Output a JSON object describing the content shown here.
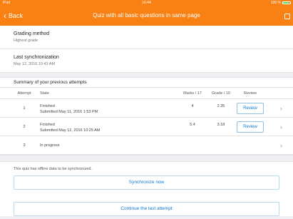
{
  "status_bar": {
    "carrier": "iPad",
    "time": "16:44",
    "battery": "100 %",
    "battery_color": "#4cd964"
  },
  "nav": {
    "back_label": "Back",
    "title": "Quiz with all basic questions in same page",
    "bar_color": "#f98012"
  },
  "info": [
    {
      "title": "Grading method",
      "value": "Highest grade"
    },
    {
      "title": "Last synchronization",
      "value": "May 12, 2016 10:43 AM"
    }
  ],
  "summary": {
    "title": "Summary of your previous attempts",
    "headers": {
      "attempt": "Attempt",
      "state": "State",
      "marks": "Marks / 17",
      "grade": "Grade / 10",
      "review": "Review"
    },
    "rows": [
      {
        "attempt": "1",
        "state": "Finished",
        "submitted": "Submitted May 11, 2016 1:53 PM",
        "marks": "4",
        "grade": "2.35",
        "review": "Review"
      },
      {
        "attempt": "2",
        "state": "Finished",
        "submitted": "Submitted May 12, 2016 10:25 AM",
        "marks": "5.4",
        "grade": "3.18",
        "review": "Review"
      },
      {
        "attempt": "3",
        "state": "In progress",
        "submitted": "",
        "marks": "",
        "grade": "",
        "review": ""
      }
    ]
  },
  "sync": {
    "note": "This quiz has offline data to be synchronized.",
    "sync_button": "Synchronize now",
    "continue_button": "Continue the last attempt"
  },
  "colors": {
    "accent": "#1177d1",
    "brand": "#f98012"
  }
}
